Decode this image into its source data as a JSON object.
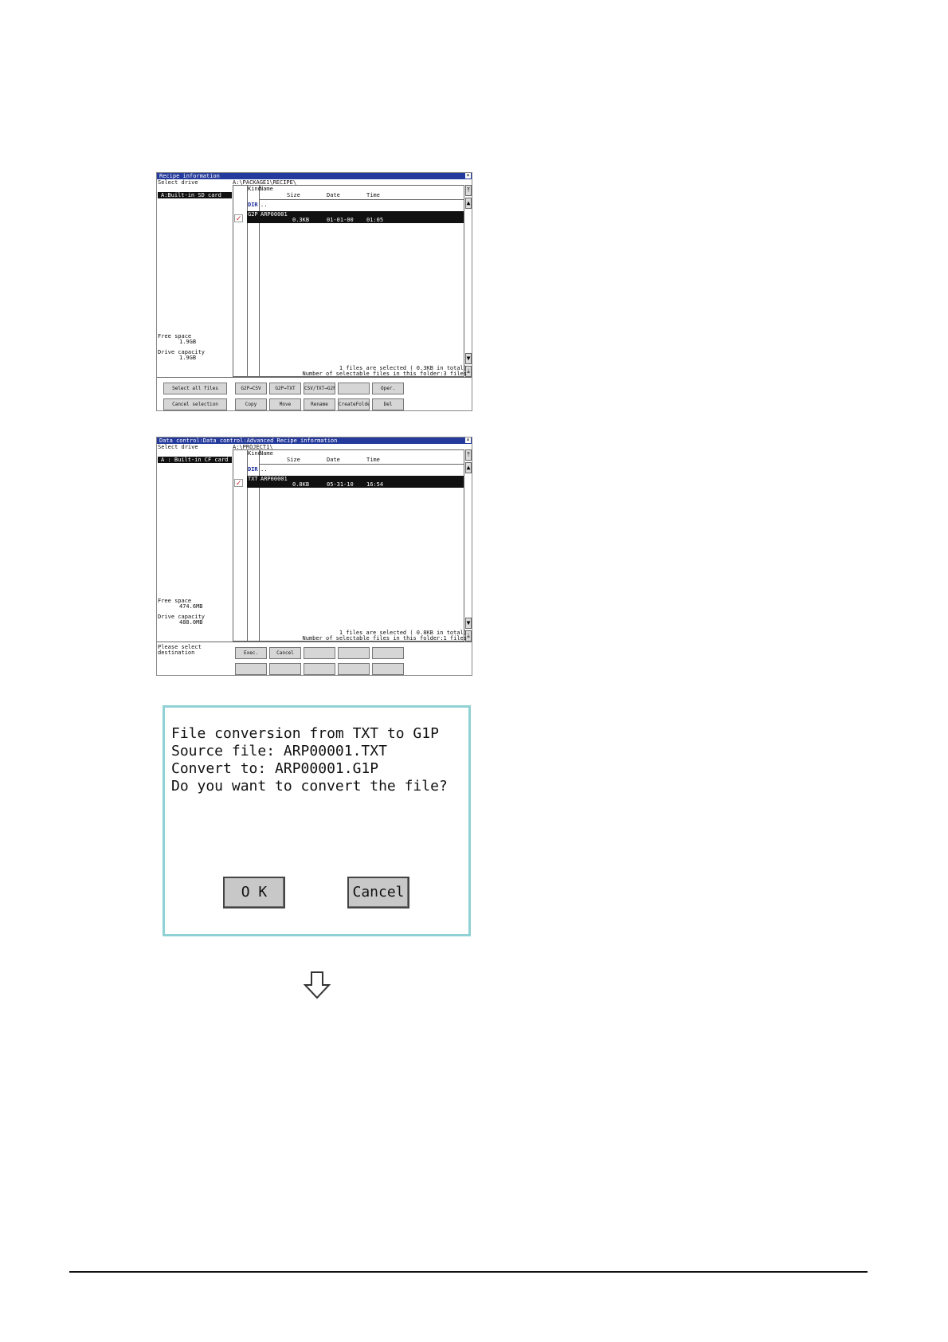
{
  "screen1": {
    "title": "Recipe information",
    "select_drive_label": "Select drive",
    "drive": "A:Built-in SD card",
    "path": "A:\\PACKAGE1\\RECIPE\\",
    "headers": {
      "kind": "Kind",
      "name": "Name",
      "size": "Size",
      "date": "Date",
      "time": "Time"
    },
    "dir_tag": "DIR",
    "parent": "..",
    "file": {
      "kind": "G2P",
      "name": "ARP00001",
      "size": "0.3KB",
      "date": "01-01-00",
      "time": "01:05"
    },
    "free_space_label": "Free space",
    "free_space": "1.9GB",
    "drive_capacity_label": "Drive capacity",
    "drive_capacity": "1.9GB",
    "status_selected": "1 files are selected (   0.3KB in total)",
    "status_count": "Number of selectable files in this folder:3 files",
    "buttons_row1": [
      "Select all files",
      "G2P→CSV",
      "G2P→TXT",
      "CSV/TXT→G2P",
      "",
      "Oper."
    ],
    "buttons_row2": [
      "Cancel selection",
      "Copy",
      "Move",
      "Rename",
      "CreateFolder",
      "Del"
    ]
  },
  "screen2": {
    "title": "Data control:Data control:Advanced Recipe information",
    "select_drive_label": "Select drive",
    "drive": "A : Built-in CF card",
    "path": "A:\\PROJECT1\\",
    "headers": {
      "kind": "Kind",
      "name": "Name",
      "size": "Size",
      "date": "Date",
      "time": "Time"
    },
    "dir_tag": "DIR",
    "parent": "..",
    "file": {
      "kind": "TXT",
      "name": "ARP00001",
      "size": "0.8KB",
      "date": "05-31-10",
      "time": "16:54"
    },
    "free_space_label": "Free space",
    "free_space": "474.6MB",
    "drive_capacity_label": "Drive capacity",
    "drive_capacity": "488.0MB",
    "status_selected": "1 files are selected (   0.8KB in total)",
    "status_count": "Number of selectable files in this folder:1 files",
    "prompt_line1": "Please select",
    "prompt_line2": "destination",
    "buttons_row1": [
      "Exec.",
      "Cancel",
      "",
      "",
      ""
    ],
    "buttons_row2": [
      "",
      "",
      "",
      "",
      ""
    ]
  },
  "dialog": {
    "line1": "File conversion from TXT to G1P",
    "line2": "Source file:   ARP00001.TXT",
    "line3": "Convert to:    ARP00001.G1P",
    "line4": "Do you want to convert the file?",
    "ok": "O K",
    "cancel": "Cancel"
  },
  "colors": {
    "titlebar": "#243a9c",
    "dialog_border": "#8fd1d4",
    "check": "#c81e1e"
  },
  "icons": {
    "close": "close-icon",
    "arrow": "arrow-down-icon",
    "check": "checkbox-icon"
  }
}
